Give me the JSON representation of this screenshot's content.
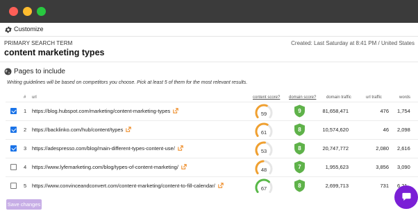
{
  "window": {
    "controls": [
      "close",
      "minimize",
      "maximize"
    ]
  },
  "toolbar": {
    "customize_label": "Customize",
    "icon": "gear-icon"
  },
  "header": {
    "primary_label": "PRIMARY SEARCH TERM",
    "created": "Created: Last Saturday at 8:41 PM / United States",
    "title": "content marketing types"
  },
  "section": {
    "icon": "globe-icon",
    "title": "Pages to include",
    "guidelines": "Writing guidelines will be based on competitors you choose. Pick at least 5 of them for the most relevant results."
  },
  "table": {
    "headers": {
      "num": "#",
      "url": "url",
      "content_score": "content score",
      "domain_score": "domain score",
      "domain_traffic": "domain traffic",
      "url_traffic": "url traffic",
      "words": "words"
    },
    "rows": [
      {
        "checked": true,
        "num": "1",
        "url": "https://blog.hubspot.com/marketing/content-marketing-types",
        "content_score": "59",
        "content_fraction": 0.59,
        "domain_score": "9",
        "domain_traffic": "81,658,471",
        "url_traffic": "476",
        "words": "1,754"
      },
      {
        "checked": true,
        "num": "2",
        "url": "https://backlinko.com/hub/content/types",
        "content_score": "61",
        "content_fraction": 0.61,
        "domain_score": "8",
        "domain_traffic": "10,574,620",
        "url_traffic": "46",
        "words": "2,098"
      },
      {
        "checked": true,
        "num": "3",
        "url": "https://adespresso.com/blog/main-different-types-content-use/",
        "content_score": "53",
        "content_fraction": 0.53,
        "domain_score": "8",
        "domain_traffic": "20,747,772",
        "url_traffic": "2,080",
        "words": "2,616"
      },
      {
        "checked": false,
        "num": "4",
        "url": "https://www.lyfemarketing.com/blog/types-of-content-marketing/",
        "content_score": "48",
        "content_fraction": 0.48,
        "domain_score": "7",
        "domain_traffic": "1,955,623",
        "url_traffic": "3,856",
        "words": "3,090"
      },
      {
        "checked": false,
        "num": "5",
        "url": "https://www.convinceandconvert.com/content-marketing/content-to-fill-calendar/",
        "content_score": "67",
        "content_fraction": 0.67,
        "domain_score": "8",
        "domain_traffic": "2,699,713",
        "url_traffic": "731",
        "words": "6,21"
      }
    ]
  },
  "footer": {
    "save_label": "Save changes"
  },
  "colors": {
    "titlebar": "#3b3b3b",
    "gauge_low": "#f0a030",
    "gauge_high": "#58b847",
    "gauge_track": "#e6e6e6",
    "shield": "#5fb24a",
    "save_button": "#c7aee6",
    "chat": "#7a1fd6",
    "checkbox": "#1a73e8",
    "link_icon": "#ee8a23"
  }
}
